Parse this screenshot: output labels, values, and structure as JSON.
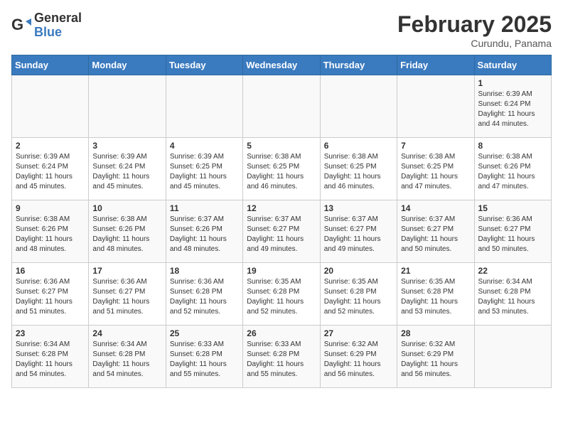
{
  "header": {
    "logo_general": "General",
    "logo_blue": "Blue",
    "month_title": "February 2025",
    "subtitle": "Curundu, Panama"
  },
  "weekdays": [
    "Sunday",
    "Monday",
    "Tuesday",
    "Wednesday",
    "Thursday",
    "Friday",
    "Saturday"
  ],
  "weeks": [
    [
      {
        "day": "",
        "info": ""
      },
      {
        "day": "",
        "info": ""
      },
      {
        "day": "",
        "info": ""
      },
      {
        "day": "",
        "info": ""
      },
      {
        "day": "",
        "info": ""
      },
      {
        "day": "",
        "info": ""
      },
      {
        "day": "1",
        "info": "Sunrise: 6:39 AM\nSunset: 6:24 PM\nDaylight: 11 hours\nand 44 minutes."
      }
    ],
    [
      {
        "day": "2",
        "info": "Sunrise: 6:39 AM\nSunset: 6:24 PM\nDaylight: 11 hours\nand 45 minutes."
      },
      {
        "day": "3",
        "info": "Sunrise: 6:39 AM\nSunset: 6:24 PM\nDaylight: 11 hours\nand 45 minutes."
      },
      {
        "day": "4",
        "info": "Sunrise: 6:39 AM\nSunset: 6:25 PM\nDaylight: 11 hours\nand 45 minutes."
      },
      {
        "day": "5",
        "info": "Sunrise: 6:38 AM\nSunset: 6:25 PM\nDaylight: 11 hours\nand 46 minutes."
      },
      {
        "day": "6",
        "info": "Sunrise: 6:38 AM\nSunset: 6:25 PM\nDaylight: 11 hours\nand 46 minutes."
      },
      {
        "day": "7",
        "info": "Sunrise: 6:38 AM\nSunset: 6:25 PM\nDaylight: 11 hours\nand 47 minutes."
      },
      {
        "day": "8",
        "info": "Sunrise: 6:38 AM\nSunset: 6:26 PM\nDaylight: 11 hours\nand 47 minutes."
      }
    ],
    [
      {
        "day": "9",
        "info": "Sunrise: 6:38 AM\nSunset: 6:26 PM\nDaylight: 11 hours\nand 48 minutes."
      },
      {
        "day": "10",
        "info": "Sunrise: 6:38 AM\nSunset: 6:26 PM\nDaylight: 11 hours\nand 48 minutes."
      },
      {
        "day": "11",
        "info": "Sunrise: 6:37 AM\nSunset: 6:26 PM\nDaylight: 11 hours\nand 48 minutes."
      },
      {
        "day": "12",
        "info": "Sunrise: 6:37 AM\nSunset: 6:27 PM\nDaylight: 11 hours\nand 49 minutes."
      },
      {
        "day": "13",
        "info": "Sunrise: 6:37 AM\nSunset: 6:27 PM\nDaylight: 11 hours\nand 49 minutes."
      },
      {
        "day": "14",
        "info": "Sunrise: 6:37 AM\nSunset: 6:27 PM\nDaylight: 11 hours\nand 50 minutes."
      },
      {
        "day": "15",
        "info": "Sunrise: 6:36 AM\nSunset: 6:27 PM\nDaylight: 11 hours\nand 50 minutes."
      }
    ],
    [
      {
        "day": "16",
        "info": "Sunrise: 6:36 AM\nSunset: 6:27 PM\nDaylight: 11 hours\nand 51 minutes."
      },
      {
        "day": "17",
        "info": "Sunrise: 6:36 AM\nSunset: 6:27 PM\nDaylight: 11 hours\nand 51 minutes."
      },
      {
        "day": "18",
        "info": "Sunrise: 6:36 AM\nSunset: 6:28 PM\nDaylight: 11 hours\nand 52 minutes."
      },
      {
        "day": "19",
        "info": "Sunrise: 6:35 AM\nSunset: 6:28 PM\nDaylight: 11 hours\nand 52 minutes."
      },
      {
        "day": "20",
        "info": "Sunrise: 6:35 AM\nSunset: 6:28 PM\nDaylight: 11 hours\nand 52 minutes."
      },
      {
        "day": "21",
        "info": "Sunrise: 6:35 AM\nSunset: 6:28 PM\nDaylight: 11 hours\nand 53 minutes."
      },
      {
        "day": "22",
        "info": "Sunrise: 6:34 AM\nSunset: 6:28 PM\nDaylight: 11 hours\nand 53 minutes."
      }
    ],
    [
      {
        "day": "23",
        "info": "Sunrise: 6:34 AM\nSunset: 6:28 PM\nDaylight: 11 hours\nand 54 minutes."
      },
      {
        "day": "24",
        "info": "Sunrise: 6:34 AM\nSunset: 6:28 PM\nDaylight: 11 hours\nand 54 minutes."
      },
      {
        "day": "25",
        "info": "Sunrise: 6:33 AM\nSunset: 6:28 PM\nDaylight: 11 hours\nand 55 minutes."
      },
      {
        "day": "26",
        "info": "Sunrise: 6:33 AM\nSunset: 6:28 PM\nDaylight: 11 hours\nand 55 minutes."
      },
      {
        "day": "27",
        "info": "Sunrise: 6:32 AM\nSunset: 6:29 PM\nDaylight: 11 hours\nand 56 minutes."
      },
      {
        "day": "28",
        "info": "Sunrise: 6:32 AM\nSunset: 6:29 PM\nDaylight: 11 hours\nand 56 minutes."
      },
      {
        "day": "",
        "info": ""
      }
    ]
  ]
}
